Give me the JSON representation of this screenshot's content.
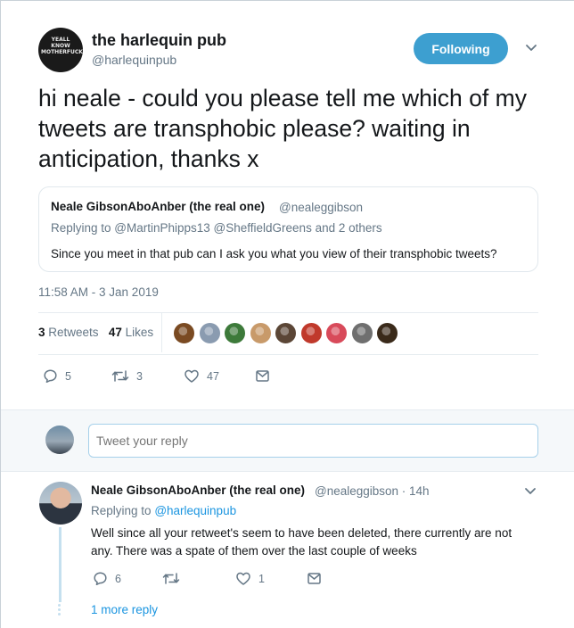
{
  "tweet": {
    "author_name": "the harlequin pub",
    "author_handle": "@harlequinpub",
    "avatar_text": "YEALL KNOW\nMOTHERFUCKER",
    "follow_label": "Following",
    "text": "hi neale - could you please tell me which of my tweets are transphobic please? waiting in anticipation, thanks x",
    "timestamp": "11:58 AM - 3 Jan 2019",
    "retweets_count": "3",
    "retweets_label": "Retweets",
    "likes_count": "47",
    "likes_label": "Likes",
    "liker_avatar_colors": [
      "#7a4a22",
      "#8a9bb0",
      "#3d7a3a",
      "#c89a6a",
      "#5b4636",
      "#c0392b",
      "#d84a5a",
      "#6f6f6f",
      "#3a2a1a"
    ],
    "actions": {
      "reply_count": "5",
      "retweet_count": "3",
      "like_count": "47"
    }
  },
  "quoted_tweet": {
    "author_name": "Neale GibsonAboAnber (the real one)",
    "author_handle": "@nealeggibson",
    "replying_to": "Replying to @MartinPhipps13 @SheffieldGreens and 2 others",
    "text": "Since you meet in that pub can I ask you what you view of their transphobic tweets?"
  },
  "reply_box": {
    "placeholder": "Tweet your reply"
  },
  "reply": {
    "author_name": "Neale GibsonAboAnber (the real one)",
    "meta": "@nealeggibson · 14h",
    "replying_prefix": "Replying to",
    "replying_handle": "@harlequinpub",
    "text": "Well since all your retweet's seem to have been deleted, there currently are not any. There was a spate of them over the last couple of weeks",
    "reply_count": "6",
    "retweet_count": "",
    "like_count": "1",
    "more_replies": "1 more reply"
  },
  "colors": {
    "accent": "#1b95e0",
    "follow_button": "#3d9fd0",
    "muted": "#657786"
  }
}
